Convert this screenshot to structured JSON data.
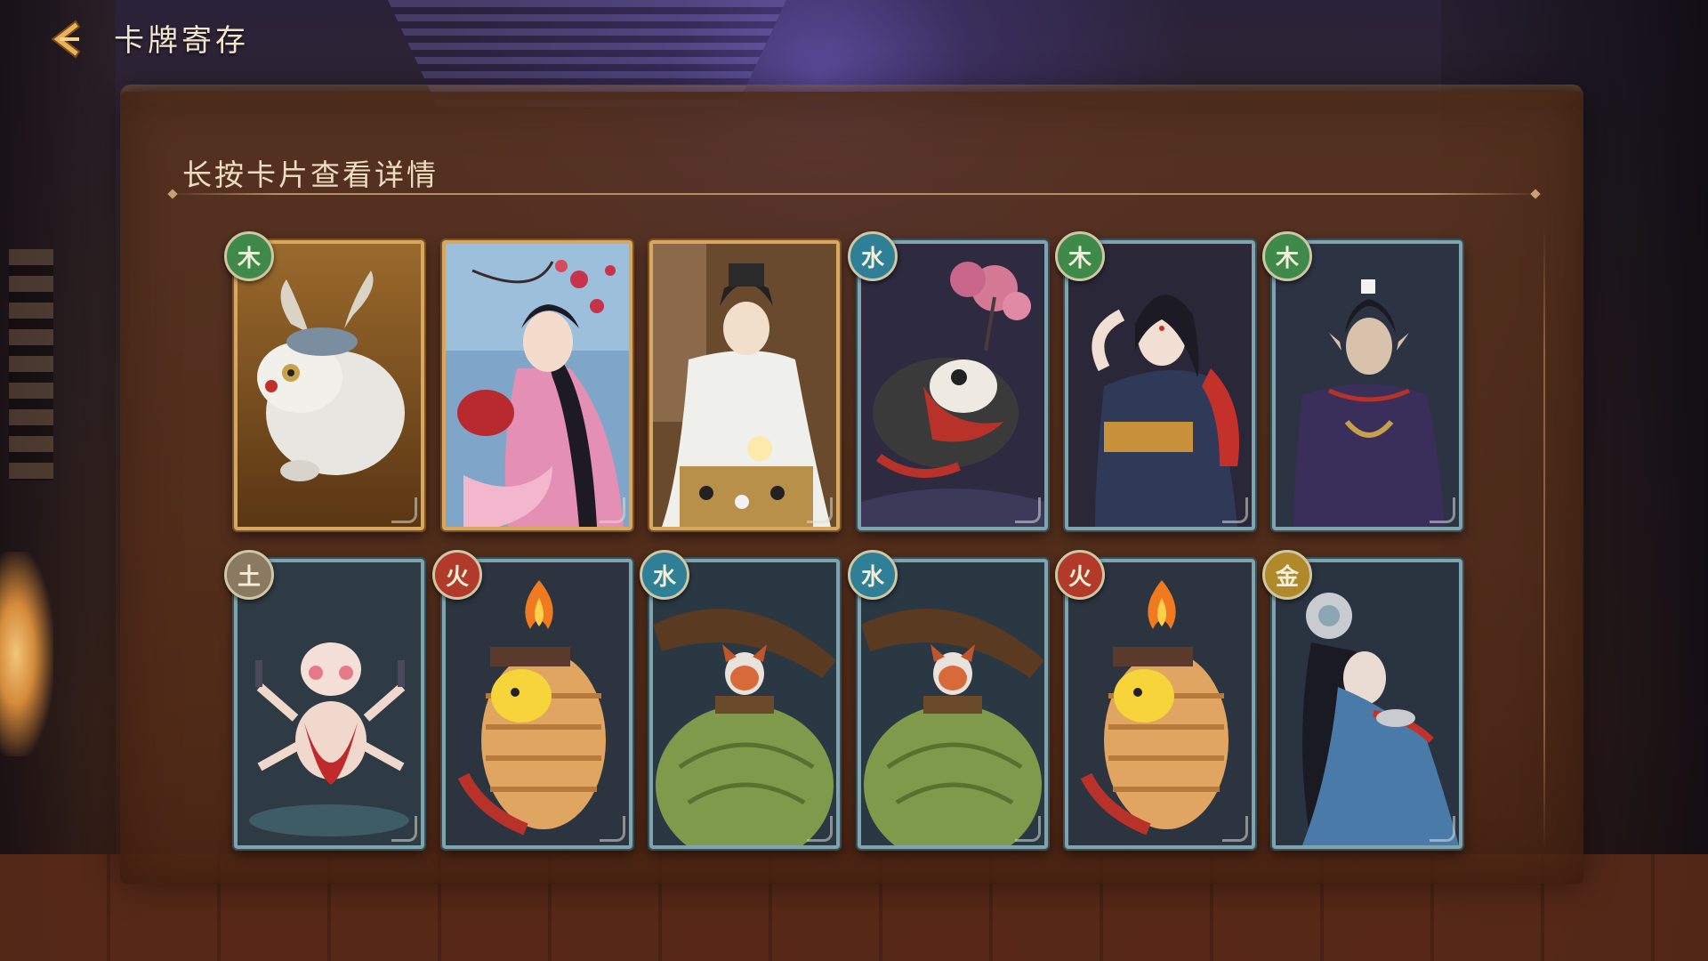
{
  "header": {
    "title": "卡牌寄存"
  },
  "panel": {
    "hint": "长按卡片查看详情"
  },
  "cards": [
    {
      "element": "木",
      "element_color": "#3f8a4a",
      "frame": "gold",
      "name": "white-beast-card"
    },
    {
      "element": "",
      "element_color": "",
      "frame": "gold",
      "name": "pink-kimono-girl-card"
    },
    {
      "element": "",
      "element_color": "",
      "frame": "gold",
      "name": "go-player-card"
    },
    {
      "element": "水",
      "element_color": "#2f7f97",
      "frame": "blue",
      "name": "koi-fish-card"
    },
    {
      "element": "木",
      "element_color": "#3f8a4a",
      "frame": "blue",
      "name": "dancer-woman-card"
    },
    {
      "element": "木",
      "element_color": "#3f8a4a",
      "frame": "blue",
      "name": "elf-man-card"
    },
    {
      "element": "土",
      "element_color": "#8a7a62",
      "frame": "blue",
      "name": "multi-arm-child-card"
    },
    {
      "element": "火",
      "element_color": "#b23a2a",
      "frame": "blue",
      "name": "fire-lantern-pikachu-card"
    },
    {
      "element": "水",
      "element_color": "#2f7f97",
      "frame": "blue",
      "name": "red-panda-turtle-card"
    },
    {
      "element": "水",
      "element_color": "#2f7f97",
      "frame": "blue",
      "name": "red-panda-turtle-card"
    },
    {
      "element": "火",
      "element_color": "#b23a2a",
      "frame": "blue",
      "name": "fire-lantern-pikachu-card"
    },
    {
      "element": "金",
      "element_color": "#b08a2a",
      "frame": "blue",
      "name": "silver-hair-lady-card"
    }
  ]
}
